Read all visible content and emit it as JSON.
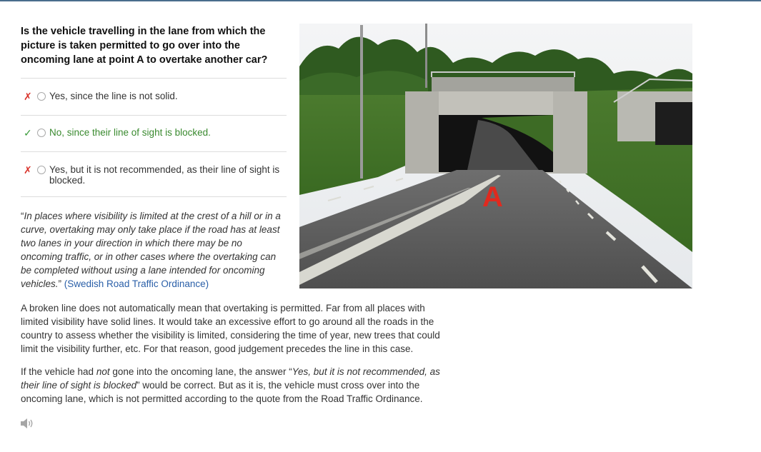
{
  "question": "Is the vehicle travelling in the lane from which the picture is taken permitted to go over into the oncoming lane at point A to overtake another car?",
  "answers": [
    {
      "mark": "✗",
      "label": "Yes, since the line is not solid.",
      "status": "wrong"
    },
    {
      "mark": "✓",
      "label": "No, since their line of sight is blocked.",
      "status": "correct"
    },
    {
      "mark": "✗",
      "label": "Yes, but it is not recommended, as their line of sight is blocked.",
      "status": "wrong"
    }
  ],
  "quote": {
    "open_mark": "“",
    "text": "In places where visibility is limited at the crest of a hill or in a curve, overtaking may only take place if the road has at least two lanes in your direction in which there may be no oncoming traffic, or in other cases where the overtaking can be completed without using a lane intended for oncoming vehicles.",
    "close_mark": "” ",
    "source": "(Swedish Road Traffic Ordinance)"
  },
  "explanation": {
    "p1": "A broken line does not automatically mean that overtaking is permitted. Far from all places with limited visibility have solid lines. It would take an excessive effort to go around all the roads in the country to assess whether the visibility is limited, considering the time of year, new trees that could limit the visibility further, etc. For that reason, good judgement precedes the line in this case.",
    "p2_a": "If the vehicle had ",
    "p2_not": "not",
    "p2_b": " gone into the oncoming lane, the answer “",
    "p2_quote": "Yes, but it is not recommended, as their line of sight is blocked",
    "p2_c": "” would be correct. But as it is, the vehicle must cross over into the oncoming lane, which is not permitted according to the quote from the Road Traffic Ordinance."
  },
  "image": {
    "point_label": "A"
  },
  "icons": {
    "audio": "speaker-icon"
  },
  "colors": {
    "wrong": "#d9332b",
    "correct": "#3a8a2f",
    "link": "#2a5fa8",
    "point_label": "#e02a1f"
  }
}
